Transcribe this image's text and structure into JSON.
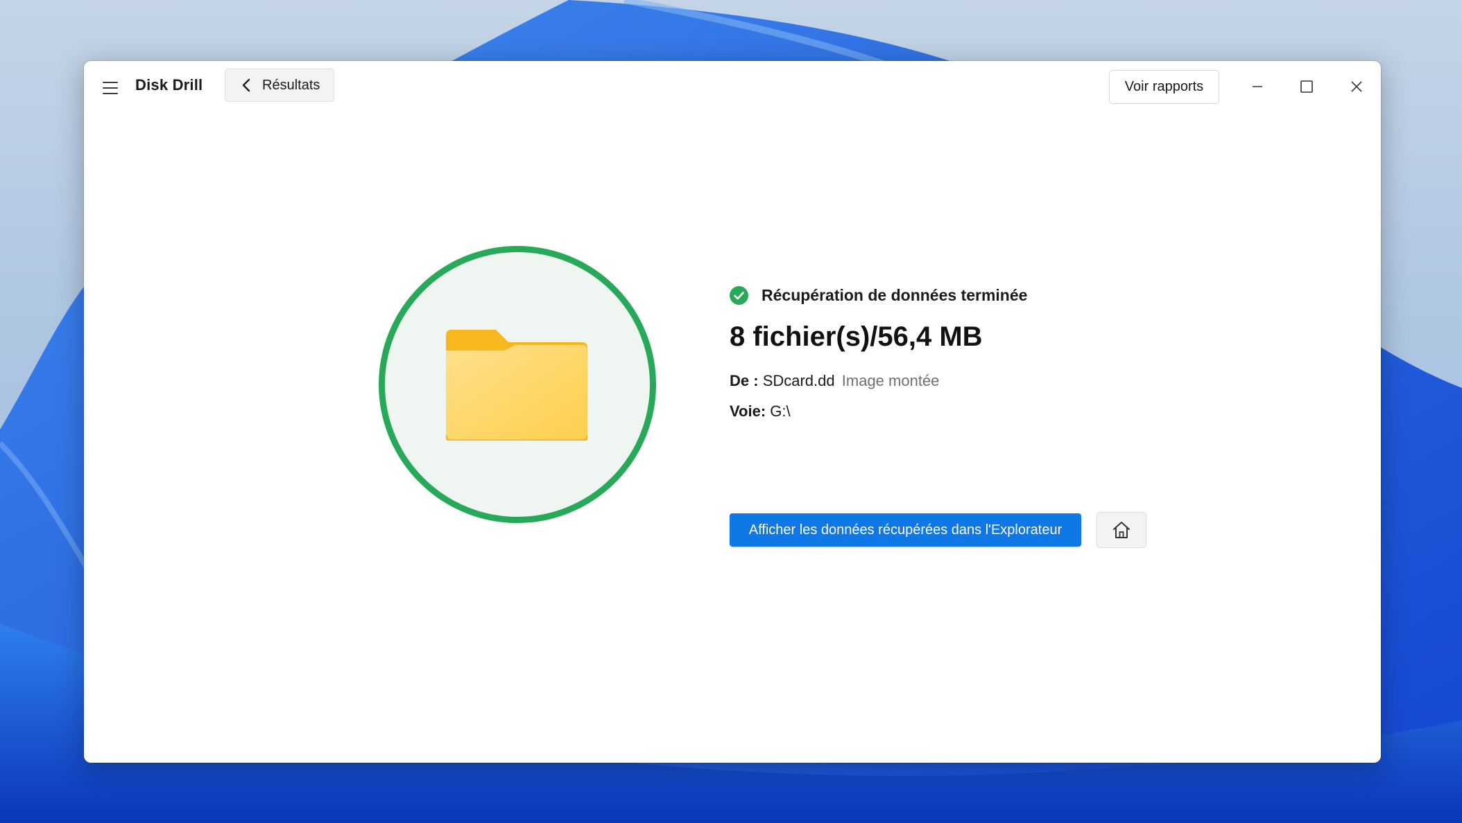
{
  "app": {
    "title": "Disk Drill"
  },
  "toolbar": {
    "back_label": "Résultats",
    "reports_label": "Voir rapports"
  },
  "result": {
    "status": "Récupération de données terminée",
    "summary": "8 fichier(s)/56,4 MB",
    "source_label": "De :",
    "source_value": "SDcard.dd",
    "source_type": "Image montée",
    "path_label": "Voie:",
    "path_value": "G:\\"
  },
  "actions": {
    "open_explorer_label": "Afficher les données récupérées dans l'Explorateur"
  },
  "icons": {
    "menu": "hamburger-icon",
    "back": "chevron-left-icon",
    "minimize": "minimize-icon",
    "maximize": "maximize-icon",
    "close": "close-icon",
    "status": "check-circle-icon",
    "folder": "folder-icon",
    "home": "home-icon"
  },
  "colors": {
    "accent": "#0f78e6",
    "success": "#27a959",
    "folder": "#fbc02d"
  }
}
